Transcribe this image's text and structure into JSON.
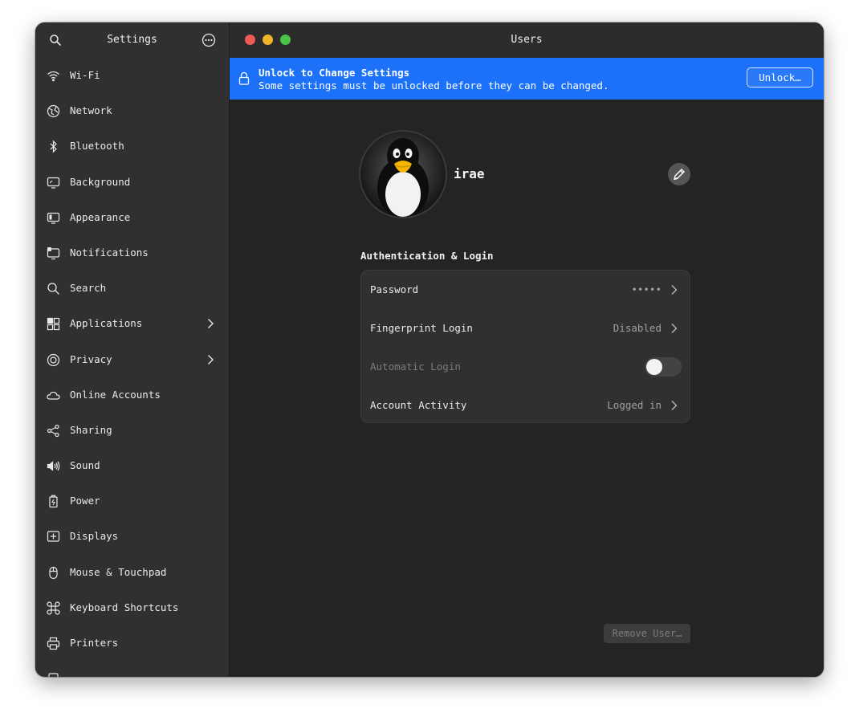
{
  "sidebar": {
    "title": "Settings",
    "items": [
      {
        "label": "Wi-Fi",
        "icon": "wifi-icon"
      },
      {
        "label": "Network",
        "icon": "network-icon"
      },
      {
        "label": "Bluetooth",
        "icon": "bluetooth-icon"
      },
      {
        "label": "Background",
        "icon": "background-icon"
      },
      {
        "label": "Appearance",
        "icon": "appearance-icon"
      },
      {
        "label": "Notifications",
        "icon": "notifications-icon"
      },
      {
        "label": "Search",
        "icon": "search-icon"
      },
      {
        "label": "Applications",
        "icon": "applications-icon",
        "has_submenu": true
      },
      {
        "label": "Privacy",
        "icon": "privacy-icon",
        "has_submenu": true
      },
      {
        "label": "Online Accounts",
        "icon": "cloud-icon"
      },
      {
        "label": "Sharing",
        "icon": "sharing-icon"
      },
      {
        "label": "Sound",
        "icon": "sound-icon"
      },
      {
        "label": "Power",
        "icon": "power-icon"
      },
      {
        "label": "Displays",
        "icon": "displays-icon"
      },
      {
        "label": "Mouse & Touchpad",
        "icon": "mouse-icon"
      },
      {
        "label": "Keyboard Shortcuts",
        "icon": "keyboard-shortcuts-icon"
      },
      {
        "label": "Printers",
        "icon": "printer-icon"
      }
    ]
  },
  "window": {
    "title": "Users"
  },
  "banner": {
    "title": "Unlock to Change Settings",
    "subtitle": "Some settings must be unlocked before they can be changed.",
    "button": "Unlock…"
  },
  "user": {
    "name": "irae"
  },
  "auth": {
    "heading": "Authentication & Login",
    "rows": [
      {
        "label": "Password",
        "value": "•••••",
        "type": "link"
      },
      {
        "label": "Fingerprint Login",
        "value": "Disabled",
        "type": "link"
      },
      {
        "label": "Automatic Login",
        "value": "",
        "type": "toggle",
        "enabled": false
      },
      {
        "label": "Account Activity",
        "value": "Logged in",
        "type": "link"
      }
    ]
  },
  "actions": {
    "remove_user": "Remove User…"
  },
  "colors": {
    "accent": "#1c71f8",
    "close": "#ec5b56",
    "minimize": "#f0b429",
    "maximize": "#4cc247"
  }
}
